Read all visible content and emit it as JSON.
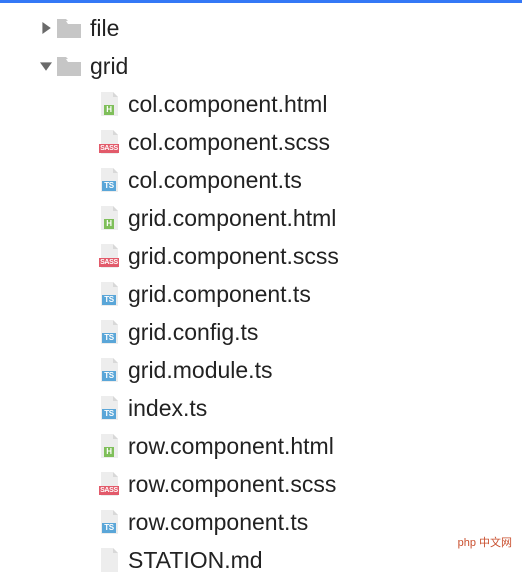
{
  "tree": {
    "folders": [
      {
        "name": "file",
        "expanded": false
      },
      {
        "name": "grid",
        "expanded": true
      }
    ],
    "grid_files": [
      {
        "name": "col.component.html",
        "type": "html",
        "badge": "H"
      },
      {
        "name": "col.component.scss",
        "type": "scss",
        "badge": "SASS"
      },
      {
        "name": "col.component.ts",
        "type": "ts",
        "badge": "TS"
      },
      {
        "name": "grid.component.html",
        "type": "html",
        "badge": "H"
      },
      {
        "name": "grid.component.scss",
        "type": "scss",
        "badge": "SASS"
      },
      {
        "name": "grid.component.ts",
        "type": "ts",
        "badge": "TS"
      },
      {
        "name": "grid.config.ts",
        "type": "ts",
        "badge": "TS"
      },
      {
        "name": "grid.module.ts",
        "type": "ts",
        "badge": "TS"
      },
      {
        "name": "index.ts",
        "type": "ts",
        "badge": "TS"
      },
      {
        "name": "row.component.html",
        "type": "html",
        "badge": "H"
      },
      {
        "name": "row.component.scss",
        "type": "scss",
        "badge": "SASS"
      },
      {
        "name": "row.component.ts",
        "type": "ts",
        "badge": "TS"
      },
      {
        "name": "STATION.md",
        "type": "md",
        "badge": ""
      }
    ]
  },
  "watermark": "php 中文网"
}
